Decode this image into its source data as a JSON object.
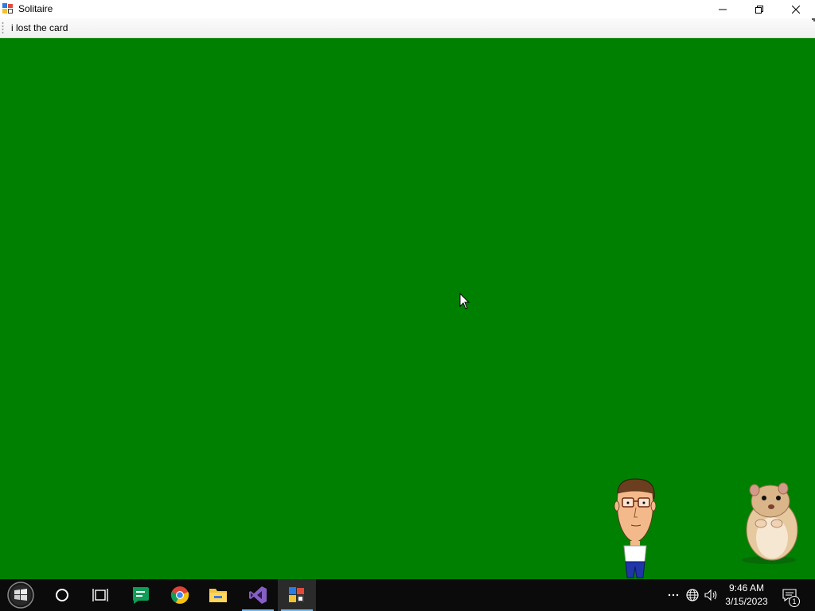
{
  "window": {
    "title": "Solitaire",
    "icon": "solitaire-app-icon",
    "controls": [
      "minimize-icon",
      "restore-icon",
      "close-icon"
    ]
  },
  "menu": {
    "items": [
      {
        "label": "i lost the card"
      }
    ]
  },
  "game": {
    "background_color": "#008000"
  },
  "taskbar": {
    "items": [
      {
        "icon": "start-windows-logo-icon"
      },
      {
        "icon": "cortana-search-circle-icon"
      },
      {
        "icon": "task-view-icon"
      },
      {
        "icon": "green-chat-app-icon"
      },
      {
        "icon": "chrome-icon"
      },
      {
        "icon": "file-explorer-icon"
      },
      {
        "icon": "visual-studio-icon"
      },
      {
        "icon": "solitaire-app-icon"
      }
    ],
    "tray": {
      "icons": [
        "more-dots-icon",
        "network-globe-icon",
        "volume-icon"
      ],
      "time": "9:46 AM",
      "date": "3/15/2023",
      "notification_count": "1"
    }
  }
}
